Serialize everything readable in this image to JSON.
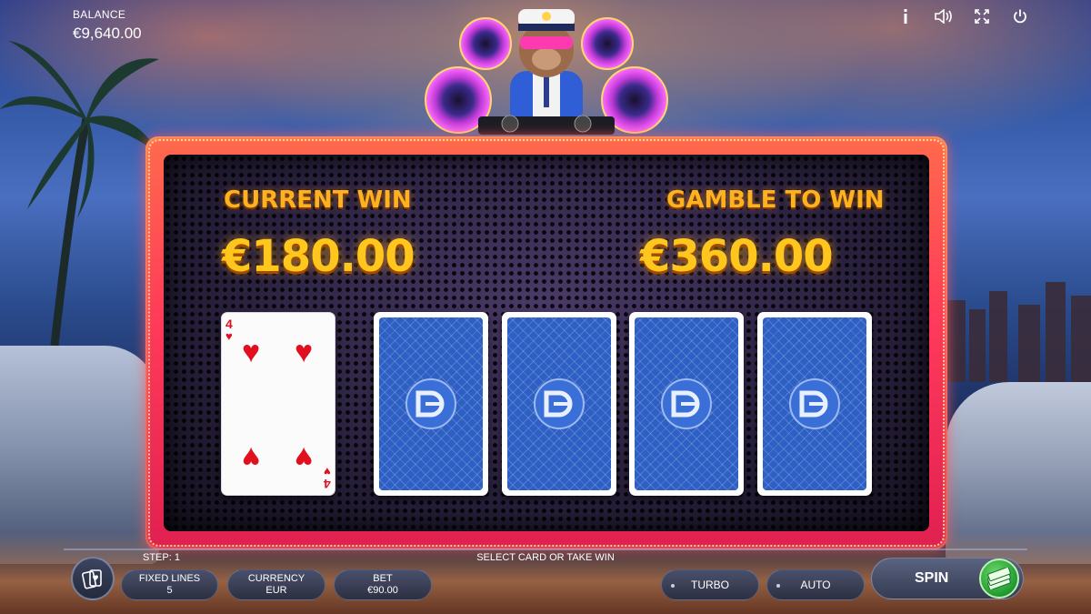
{
  "balance": {
    "label": "BALANCE",
    "value": "€9,640.00"
  },
  "top_icons": [
    "info-icon",
    "sound-icon",
    "fullscreen-icon",
    "power-icon"
  ],
  "gamble": {
    "current_win_label": "CURRENT WIN",
    "current_win_value": "€180.00",
    "gamble_to_win_label": "GAMBLE TO WIN",
    "gamble_to_win_value": "€360.00"
  },
  "cards": [
    {
      "state": "face-up",
      "rank": "4",
      "suit": "♥"
    },
    {
      "state": "face-down"
    },
    {
      "state": "face-down"
    },
    {
      "state": "face-down"
    },
    {
      "state": "face-down"
    }
  ],
  "status": {
    "step": "STEP: 1",
    "prompt": "SELECT CARD OR TAKE WIN"
  },
  "controls": {
    "fixed_lines_label": "FIXED LINES",
    "fixed_lines_value": "5",
    "currency_label": "CURRENCY",
    "currency_value": "EUR",
    "bet_label": "BET",
    "bet_value": "€90.00",
    "turbo_label": "TURBO",
    "auto_label": "AUTO",
    "spin_label": "SPIN"
  },
  "colors": {
    "win_text": "#ffc61e",
    "frame": "#ff3a5a",
    "card_back": "#2d5fc4",
    "suit_red": "#e0101e",
    "spin_green": "#1f9a2f"
  }
}
